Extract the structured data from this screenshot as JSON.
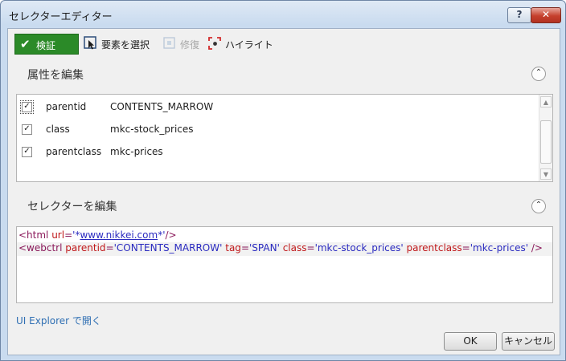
{
  "window": {
    "title": "セレクターエディター",
    "help_label": "?",
    "close_label": "✕"
  },
  "toolbar": {
    "verify_label": "検証",
    "select_element_label": "要素を選択",
    "repair_label": "修復",
    "highlight_label": "ハイライト"
  },
  "attributes_section": {
    "title": "属性を編集",
    "collapse_symbol": "⌃",
    "rows": [
      {
        "checked": "✓",
        "name": "parentid",
        "value": "CONTENTS_MARROW"
      },
      {
        "checked": "✓",
        "name": "class",
        "value": "mkc-stock_prices"
      },
      {
        "checked": "✓",
        "name": "parentclass",
        "value": "mkc-prices"
      }
    ]
  },
  "selector_section": {
    "title": "セレクターを編集",
    "collapse_symbol": "⌃",
    "line1": {
      "open": "<html ",
      "attr": "url",
      "eq": "=",
      "q1": "'*",
      "url": "www.nikkei.com",
      "q2": "*'",
      "close": "/>"
    },
    "line2": {
      "open": "<webctrl ",
      "a1": "parentid",
      "v1": "'CONTENTS_MARROW'",
      "a2": "tag",
      "v2": "'SPAN'",
      "a3": "class",
      "v3": "'mkc-stock_prices'",
      "a4": "parentclass",
      "v4": "'mkc-prices'",
      "close": "/>"
    }
  },
  "footer": {
    "open_in_explorer": "UI Explorer で開く",
    "ok_label": "OK",
    "cancel_label": "キャンセル"
  },
  "colors": {
    "verify_button": "#2b8a28",
    "link": "#2f6fb3",
    "tag": "#8b1a5b",
    "attribute": "#c0181a",
    "value": "#2a2ac0"
  }
}
